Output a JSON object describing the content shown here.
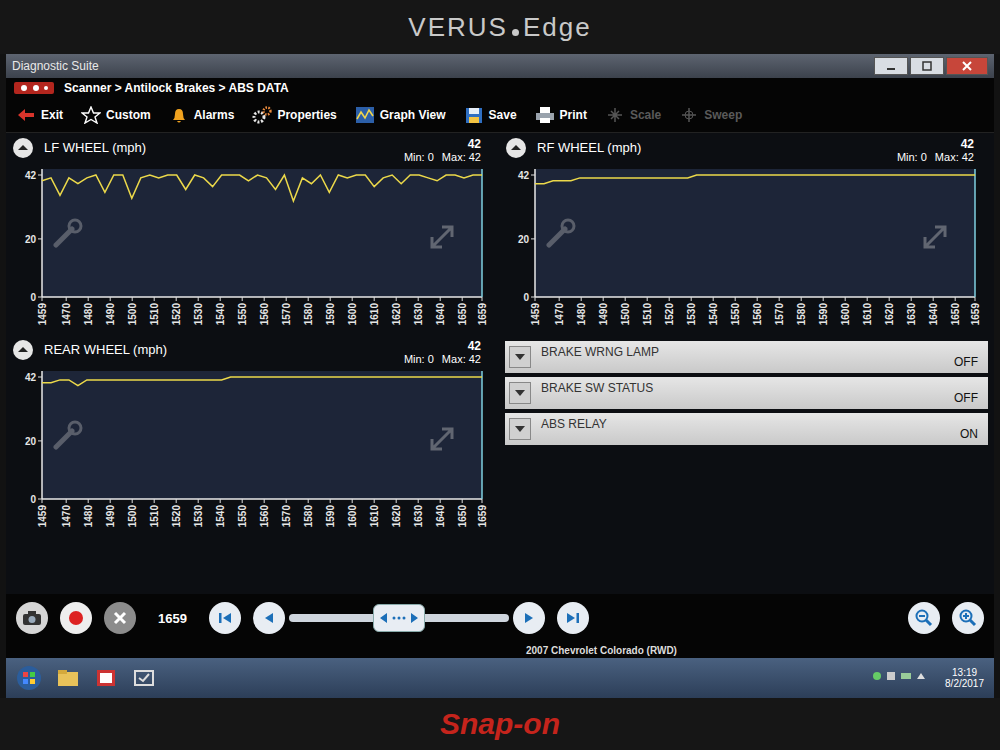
{
  "bezel": {
    "brand": "VERUS",
    "model": "Edge",
    "maker": "Snap-on"
  },
  "window": {
    "title": "Diagnostic Suite"
  },
  "breadcrumb": "Scanner > Antilock Brakes > ABS DATA",
  "toolbar": [
    {
      "label": "Exit",
      "disabled": false
    },
    {
      "label": "Custom",
      "disabled": false
    },
    {
      "label": "Alarms",
      "disabled": false
    },
    {
      "label": "Properties",
      "disabled": false
    },
    {
      "label": "Graph View",
      "disabled": false
    },
    {
      "label": "Save",
      "disabled": false
    },
    {
      "label": "Print",
      "disabled": false
    },
    {
      "label": "Scale",
      "disabled": true
    },
    {
      "label": "Sweep",
      "disabled": true
    }
  ],
  "charts": [
    {
      "title": "LF WHEEL (mph)",
      "current": "42",
      "min": "Min: 0",
      "max": "Max: 42",
      "yTicks": [
        "42",
        "20",
        "0"
      ],
      "xTicks": [
        "1459",
        "1470",
        "1480",
        "1490",
        "1500",
        "1510",
        "1520",
        "1530",
        "1540",
        "1550",
        "1560",
        "1570",
        "1580",
        "1590",
        "1600",
        "1610",
        "1620",
        "1630",
        "1640",
        "1650",
        "1659"
      ],
      "values": [
        40,
        41,
        35,
        41,
        39,
        41,
        42,
        36,
        42,
        42,
        34,
        41,
        42,
        41,
        42,
        42,
        37,
        42,
        41,
        38,
        42,
        42,
        42,
        40,
        42,
        41,
        37,
        42,
        33,
        41,
        39,
        42,
        36,
        42,
        41,
        42,
        42,
        38,
        41,
        42,
        39,
        42,
        42,
        41,
        40,
        42,
        42,
        41,
        42,
        42
      ]
    },
    {
      "title": "RF WHEEL (mph)",
      "current": "42",
      "min": "Min: 0",
      "max": "Max: 42",
      "yTicks": [
        "42",
        "20",
        "0"
      ],
      "xTicks": [
        "1459",
        "1470",
        "1480",
        "1490",
        "1500",
        "1510",
        "1520",
        "1530",
        "1540",
        "1550",
        "1560",
        "1570",
        "1580",
        "1590",
        "1600",
        "1610",
        "1620",
        "1630",
        "1640",
        "1650",
        "1659"
      ],
      "values": [
        39,
        39,
        40,
        40,
        40,
        41,
        41,
        41,
        41,
        41,
        41,
        41,
        41,
        41,
        41,
        41,
        41,
        41,
        42,
        42,
        42,
        42,
        42,
        42,
        42,
        42,
        42,
        42,
        42,
        42,
        42,
        42,
        42,
        42,
        42,
        42,
        42,
        42,
        42,
        42,
        42,
        42,
        42,
        42,
        42,
        42,
        42,
        42,
        42,
        42
      ]
    },
    {
      "title": "REAR WHEEL (mph)",
      "current": "42",
      "min": "Min: 0",
      "max": "Max: 42",
      "yTicks": [
        "42",
        "20",
        "0"
      ],
      "xTicks": [
        "1459",
        "1470",
        "1480",
        "1490",
        "1500",
        "1510",
        "1520",
        "1530",
        "1540",
        "1550",
        "1560",
        "1570",
        "1580",
        "1590",
        "1600",
        "1610",
        "1620",
        "1630",
        "1640",
        "1650",
        "1659"
      ],
      "values": [
        40,
        40,
        41,
        41,
        39,
        41,
        41,
        41,
        41,
        41,
        41,
        41,
        41,
        41,
        41,
        41,
        41,
        41,
        41,
        41,
        41,
        42,
        42,
        42,
        42,
        42,
        42,
        42,
        42,
        42,
        42,
        42,
        42,
        42,
        42,
        42,
        42,
        42,
        42,
        42,
        42,
        42,
        42,
        42,
        42,
        42,
        42,
        42,
        42,
        42
      ]
    }
  ],
  "params": [
    {
      "name": "BRAKE WRNG LAMP",
      "value": "OFF"
    },
    {
      "name": "BRAKE SW STATUS",
      "value": "OFF"
    },
    {
      "name": "ABS RELAY",
      "value": "ON"
    }
  ],
  "playback": {
    "frame": "1659",
    "level": 0.5
  },
  "status": {
    "vehicle": "2007 Chevrolet Colorado (RWD)"
  },
  "taskbar": {
    "time": "13:19",
    "date": "8/2/2017"
  }
}
